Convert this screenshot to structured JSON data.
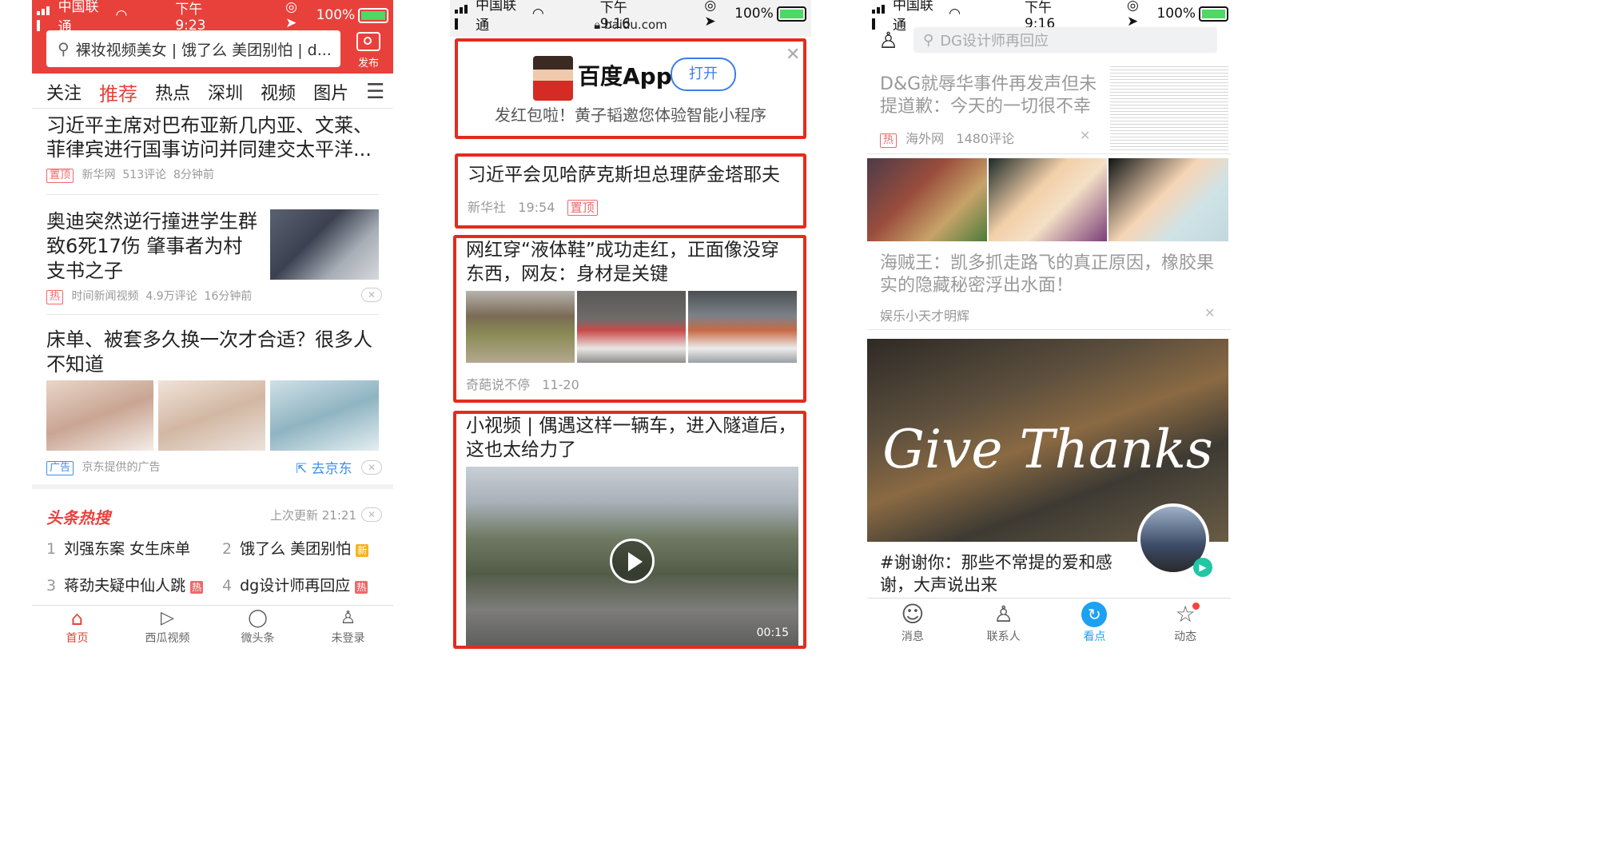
{
  "colors": {
    "toutiao_red": "#e8413b",
    "baidu_red": "#e32c1e",
    "qq_blue": "#1da1f2",
    "battery_green": "#4cd964"
  },
  "panel1": {
    "status": {
      "carrier": "中国联通",
      "time": "下午9:23",
      "battery": "100%"
    },
    "search": {
      "value": "裸妆视频美女 | 饿了么 美团别怕 | d...",
      "publish": "发布"
    },
    "tabs": [
      "关注",
      "推荐",
      "热点",
      "深圳",
      "视频",
      "图片"
    ],
    "active_tab": "推荐",
    "articles": [
      {
        "title": "习近平主席对巴布亚新几内亚、文莱、菲律宾进行国事访问并同建交太平洋...",
        "tag": "置顶",
        "source": "新华网",
        "comments": "513评论",
        "time": "8分钟前"
      },
      {
        "title": "奥迪突然逆行撞进学生群致6死17伤 肇事者为村支书之子",
        "tag": "热",
        "source": "时间新闻视频",
        "comments": "4.9万评论",
        "time": "16分钟前"
      },
      {
        "title": "床单、被套多久换一次才合适？很多人不知道",
        "tag": "广告",
        "source": "京东提供的广告",
        "action": "去京东"
      }
    ],
    "hot": {
      "title": "头条热搜",
      "updated": "上次更新 21:21",
      "items": [
        {
          "rank": "1",
          "text": "刘强东案 女生床单",
          "badge": ""
        },
        {
          "rank": "2",
          "text": "饿了么 美团别怕",
          "badge": "新"
        },
        {
          "rank": "3",
          "text": "蒋劲夫疑中仙人跳",
          "badge": "热"
        },
        {
          "rank": "4",
          "text": "dg设计师再回应",
          "badge": "热"
        }
      ]
    },
    "nav": [
      "首页",
      "西瓜视频",
      "微头条",
      "未登录"
    ]
  },
  "panel2": {
    "status": {
      "carrier": "中国联通",
      "time": "下午9:16",
      "battery": "100%",
      "url": "baidu.com"
    },
    "banner": {
      "app": "百度App",
      "open": "打开",
      "subtitle": "发红包啦！黄子韬邀您体验智能小程序"
    },
    "cards": [
      {
        "title": "习近平会见哈萨克斯坦总理萨金塔耶夫",
        "source": "新华社",
        "time": "19:54",
        "tag": "置顶"
      },
      {
        "title": "网红穿“液体鞋”成功走红，正面像没穿东西，网友：身材是关键",
        "source": "奇葩说不停",
        "time": "11-20"
      },
      {
        "title": "小视频 | 偶遇这样一辆车，进入隧道后，这也太给力了",
        "duration": "00:15"
      }
    ]
  },
  "panel3": {
    "status": {
      "carrier": "中国联通",
      "time": "下午9:16",
      "battery": "100%"
    },
    "search": {
      "placeholder": "DG设计师再回应"
    },
    "articles": [
      {
        "title": "D&G就辱华事件再发声但未提道歉：今天的一切很不幸",
        "tag": "热",
        "source": "海外网",
        "comments": "1480评论"
      },
      {
        "title": "海贼王：凯多抓走路飞的真正原因，橡胶果实的隐藏秘密浮出水面！",
        "source": "娱乐小天才明辉"
      },
      {
        "title": "#谢谢你：那些不常提的爱和感谢，大声说出来",
        "image_text": "Give Thanks"
      }
    ],
    "nav": [
      "消息",
      "联系人",
      "看点",
      "动态"
    ]
  }
}
